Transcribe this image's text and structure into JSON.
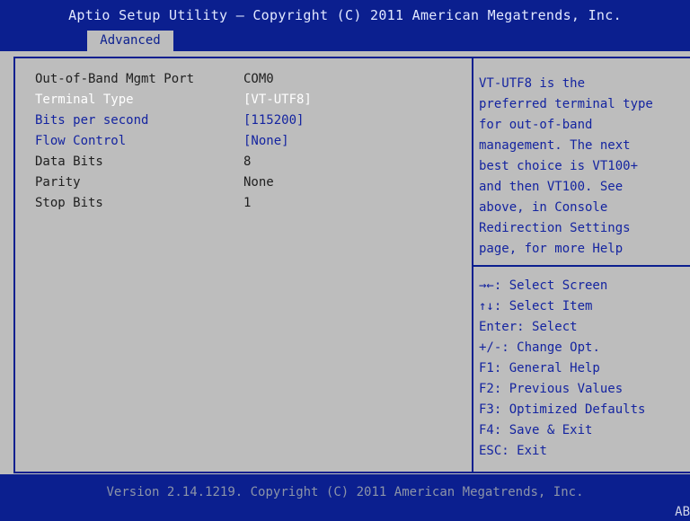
{
  "header": {
    "title": "Aptio Setup Utility – Copyright (C) 2011 American Megatrends, Inc."
  },
  "tabs": [
    {
      "label": "Advanced",
      "active": true
    }
  ],
  "settings": [
    {
      "label": "Out-of-Band Mgmt Port",
      "value": "COM0",
      "kind": "static"
    },
    {
      "label": "Terminal Type",
      "value": "[VT-UTF8]",
      "kind": "selected"
    },
    {
      "label": "Bits per second",
      "value": "[115200]",
      "kind": "editable"
    },
    {
      "label": "Flow Control",
      "value": "[None]",
      "kind": "editable"
    },
    {
      "label": "Data Bits",
      "value": "8",
      "kind": "static"
    },
    {
      "label": "Parity",
      "value": "None",
      "kind": "static"
    },
    {
      "label": "Stop Bits",
      "value": "1",
      "kind": "static"
    }
  ],
  "help": {
    "text": "VT-UTF8 is the\npreferred terminal type\nfor out-of-band\nmanagement. The next\nbest choice is VT100+\nand then VT100. See\nabove, in Console\nRedirection Settings\npage, for more Help"
  },
  "keys": [
    {
      "key": "→←",
      "desc": ": Select Screen"
    },
    {
      "key": "↑↓",
      "desc": ": Select Item"
    },
    {
      "key": "Enter",
      "desc": ": Select"
    },
    {
      "key": "+/-",
      "desc": ": Change Opt."
    },
    {
      "key": "F1",
      "desc": ": General Help"
    },
    {
      "key": "F2",
      "desc": ": Previous Values"
    },
    {
      "key": "F3",
      "desc": ": Optimized Defaults"
    },
    {
      "key": "F4",
      "desc": ": Save & Exit"
    },
    {
      "key": "ESC",
      "desc": ": Exit"
    }
  ],
  "footer": {
    "version": "Version 2.14.1219. Copyright (C) 2011 American Megatrends, Inc.",
    "corner": "AB"
  },
  "colors": {
    "header_bg": "#0b1f8f",
    "body_bg": "#bdbdbd",
    "accent_text": "#1424a0",
    "selected_text": "#ffffff"
  }
}
